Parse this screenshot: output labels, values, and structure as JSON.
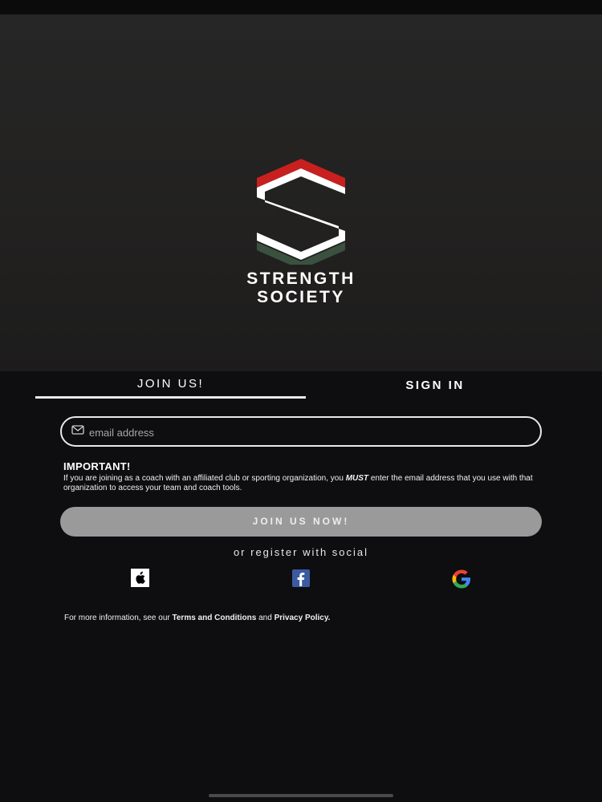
{
  "brand": {
    "line1": "STRENGTH",
    "line2": "SOCIETY",
    "colors": {
      "red": "#c8201f",
      "green": "#3f5a47",
      "white": "#ffffff"
    }
  },
  "tabs": [
    {
      "label": "JOIN US!",
      "active": true
    },
    {
      "label": "SIGN IN",
      "active": false
    }
  ],
  "email": {
    "placeholder": "email address",
    "value": ""
  },
  "important": {
    "title": "IMPORTANT!",
    "text_before": "If you are joining as a coach with an affiliated club or sporting organization, you",
    "emphasis": "MUST",
    "text_after": "enter the email address that you use with that organization to access your team and coach tools."
  },
  "join_button": {
    "label": "JOIN US NOW!"
  },
  "social": {
    "label": "or register with social",
    "providers": [
      "apple-icon",
      "facebook-icon",
      "google-icon"
    ]
  },
  "footer": {
    "prefix": "For more information, see our",
    "terms": "Terms and Conditions",
    "and": "and",
    "privacy": "Privacy Policy."
  }
}
